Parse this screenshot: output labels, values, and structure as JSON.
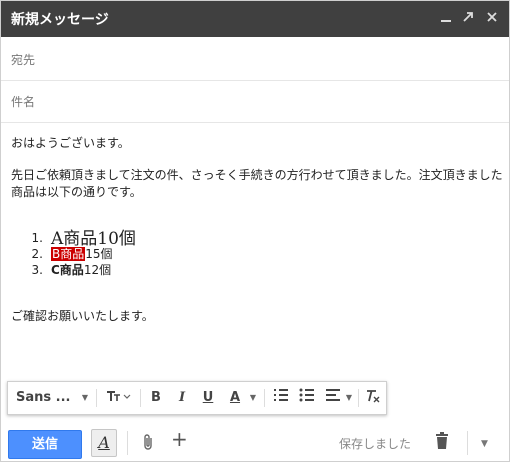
{
  "window": {
    "title": "新規メッセージ",
    "controls": {
      "minimize": "minimize-icon",
      "popout": "popout-icon",
      "close": "close-icon"
    }
  },
  "fields": {
    "to_placeholder": "宛先",
    "subject_placeholder": "件名"
  },
  "body": {
    "greeting": "おはようございます。",
    "paragraph_line1": "先日ご依頼頂きまして注文の件、さっそく手続きの方行わせて頂きました。注文頂きました",
    "paragraph_line2": "商品は以下の通りです。",
    "items": [
      {
        "num": "1.",
        "name": "A商品",
        "qty": "10個"
      },
      {
        "num": "2.",
        "name": "B商品",
        "qty": "15個"
      },
      {
        "num": "3.",
        "name": "C商品",
        "qty": "12個"
      }
    ],
    "closing": "ご確認お願いいたします。"
  },
  "format_toolbar": {
    "font": "Sans ...",
    "size_icon": "text-size-icon",
    "bold": "B",
    "italic": "I",
    "underline": "U",
    "text_color": "A",
    "numbered_list_icon": "numbered-list-icon",
    "bulleted_list_icon": "bulleted-list-icon",
    "align_icon": "align-icon",
    "remove_format_icon": "remove-formatting-icon"
  },
  "footer": {
    "send_label": "送信",
    "formatting_toggle": "A",
    "saved_status": "保存しました"
  },
  "colors": {
    "titlebar": "#404040",
    "send": "#4d90fe",
    "highlight": "#cc0000"
  }
}
